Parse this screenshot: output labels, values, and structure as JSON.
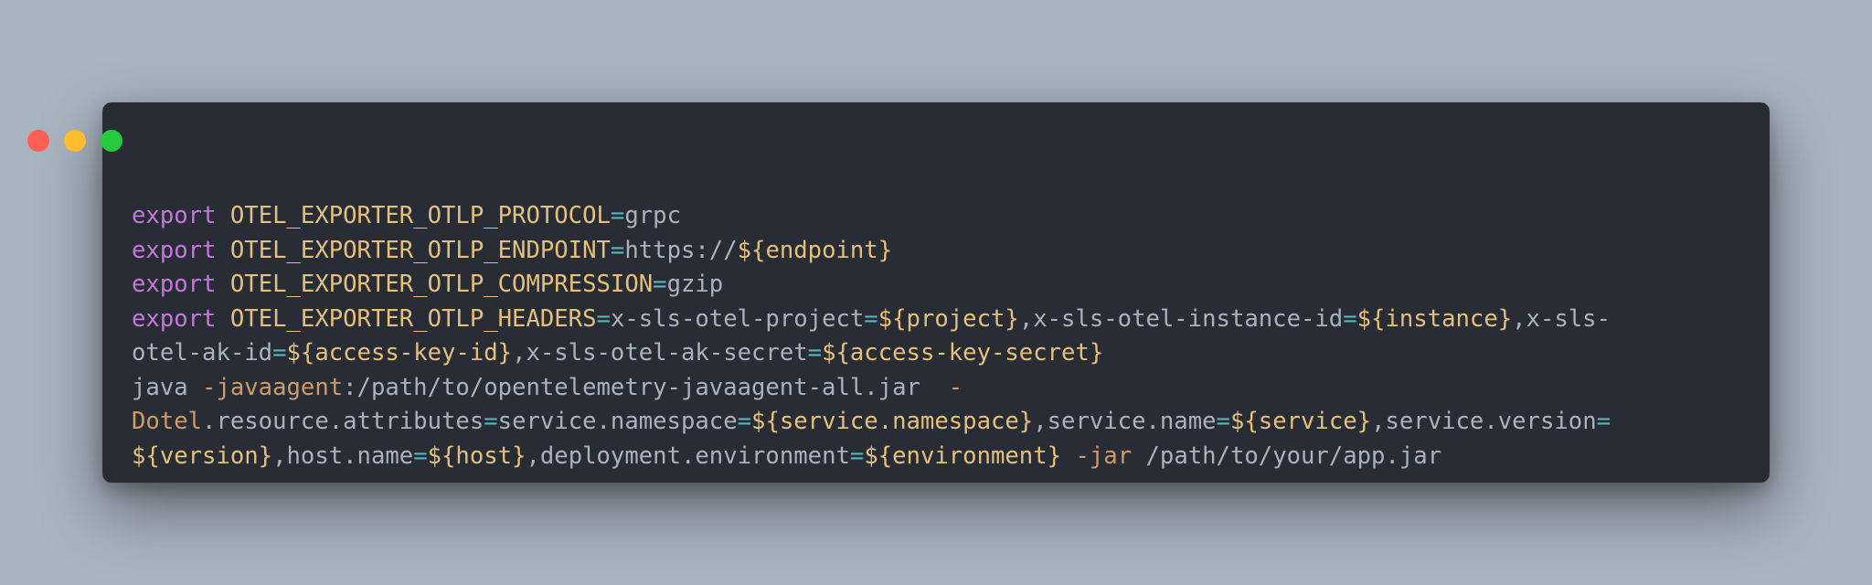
{
  "window": {
    "buttons": {
      "close_color": "#ff5f56",
      "minimize_color": "#ffbd2e",
      "maximize_color": "#27c93f"
    },
    "background_color": "#282c34"
  },
  "code": {
    "language": "bash",
    "lines": [
      "export OTEL_EXPORTER_OTLP_PROTOCOL=grpc",
      "export OTEL_EXPORTER_OTLP_ENDPOINT=https://${endpoint}",
      "export OTEL_EXPORTER_OTLP_COMPRESSION=gzip",
      "export OTEL_EXPORTER_OTLP_HEADERS=x-sls-otel-project=${project},x-sls-otel-instance-id=${instance},x-sls-",
      "otel-ak-id=${access-key-id},x-sls-otel-ak-secret=${access-key-secret}",
      "java -javaagent:/path/to/opentelemetry-javaagent-all.jar  -",
      "Dotel.resource.attributes=service.namespace=${service.namespace},service.name=${service},service.version=",
      "${version},host.name=${host},deployment.environment=${environment} -jar /path/to/your/app.jar"
    ]
  }
}
